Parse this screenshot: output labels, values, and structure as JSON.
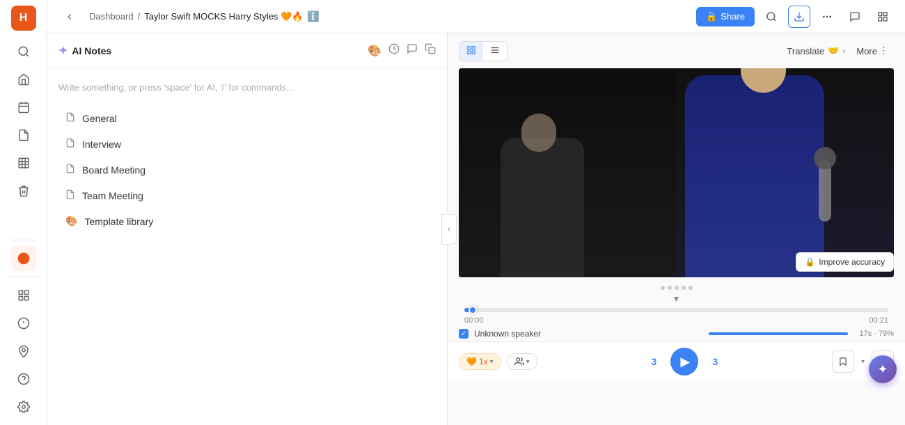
{
  "app": {
    "logo": "H"
  },
  "header": {
    "breadcrumb_home": "Dashboard",
    "breadcrumb_sep": "/",
    "breadcrumb_current": "Taylor Swift MOCKS Harry Styles 🧡🔥",
    "info_icon": "ℹ",
    "share_label": "Share",
    "lock_icon": "🔒"
  },
  "notes_panel": {
    "title": "AI Notes",
    "spark_icon": "✦",
    "placeholder": "Write something, or press 'space' for AI, '/' for commands...",
    "items": [
      {
        "label": "General",
        "icon": "📄",
        "type": "doc"
      },
      {
        "label": "Interview",
        "icon": "📄",
        "type": "doc"
      },
      {
        "label": "Board Meeting",
        "icon": "📄",
        "type": "doc"
      },
      {
        "label": "Team Meeting",
        "icon": "📄",
        "type": "doc"
      },
      {
        "label": "Template library",
        "icon": "🎨",
        "type": "template"
      }
    ]
  },
  "video_panel": {
    "translate_label": "Translate",
    "translate_emoji": "🤝",
    "more_label": "More",
    "more_dots": "⋮",
    "timeline": {
      "start": "00:00",
      "end": "00:21",
      "progress_pct": 2
    },
    "speaker": {
      "name": "Unknown speaker",
      "duration": "17s · 79%"
    },
    "improve_accuracy_label": "Improve accuracy",
    "improve_accuracy_icon": "🔒"
  },
  "controls": {
    "speed": "1x",
    "skip_back": "3",
    "skip_fwd": "3",
    "play_icon": "▶"
  },
  "left_nav": {
    "icons": [
      "🔍",
      "🏠",
      "📅",
      "📋",
      "📊",
      "🗑"
    ],
    "bottom_icons": [
      "📦",
      "💰",
      "📍",
      "❓",
      "⚙️"
    ]
  }
}
